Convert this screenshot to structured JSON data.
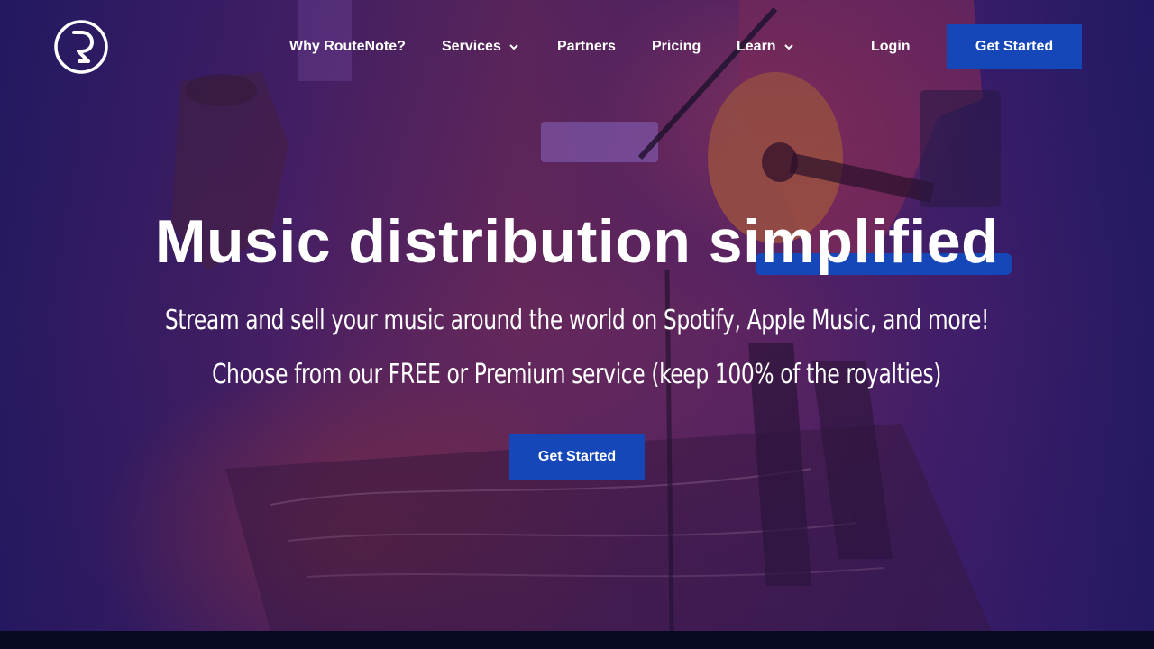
{
  "brand": {
    "logo_icon": "routenote-logo-icon",
    "accent": "#1547b8"
  },
  "nav": {
    "items": [
      {
        "label": "Why RouteNote?",
        "has_dropdown": false
      },
      {
        "label": "Services",
        "has_dropdown": true
      },
      {
        "label": "Partners",
        "has_dropdown": false
      },
      {
        "label": "Pricing",
        "has_dropdown": false
      },
      {
        "label": "Learn",
        "has_dropdown": true
      }
    ],
    "login_label": "Login",
    "cta_label": "Get Started"
  },
  "hero": {
    "headline": "Music distribution simplified",
    "line1": "Stream and sell your music around the world on Spotify, Apple Music, and more!",
    "line2": "Choose from our FREE or Premium service (keep 100% of the royalties)",
    "cta_label": "Get Started"
  }
}
